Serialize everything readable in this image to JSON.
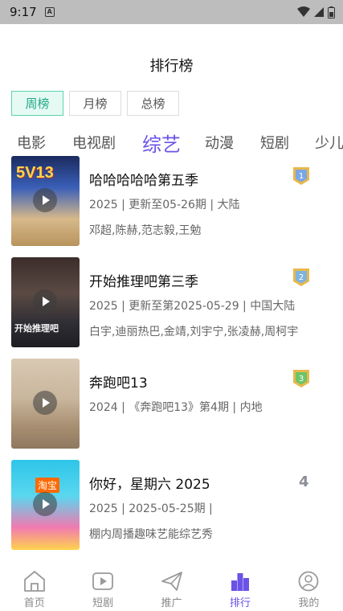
{
  "status_bar": {
    "time": "9:17",
    "notif_glyph": "A"
  },
  "header": {
    "title": "排行榜"
  },
  "period_tabs": [
    {
      "label": "周榜",
      "active": true
    },
    {
      "label": "月榜",
      "active": false
    },
    {
      "label": "总榜",
      "active": false
    }
  ],
  "category_tabs": [
    {
      "label": "电影"
    },
    {
      "label": "电视剧"
    },
    {
      "label": "综艺",
      "active": true
    },
    {
      "label": "动漫"
    },
    {
      "label": "短剧"
    },
    {
      "label": "少儿"
    }
  ],
  "items": [
    {
      "rank": "1",
      "title": "哈哈哈哈哈第五季",
      "meta": "2025 | 更新至05-26期 | 大陆",
      "cast": "邓超,陈赫,范志毅,王勉",
      "poster_text": "5V13"
    },
    {
      "rank": "2",
      "title": "开始推理吧第三季",
      "meta": "2025 | 更新至第2025-05-29 | 中国大陆",
      "cast": "白宇,迪丽热巴,金靖,刘宇宁,张凌赫,周柯宇",
      "poster_text": "开始推理吧"
    },
    {
      "rank": "3",
      "title": "奔跑吧13",
      "meta": "2024 | 《奔跑吧13》第4期 | 内地",
      "cast": ""
    },
    {
      "rank": "4",
      "title": "你好，星期六 2025",
      "meta": "2025 | 2025-05-25期 |",
      "cast": "棚内周播趣味艺能综艺秀",
      "poster_text": "淘宝"
    }
  ],
  "bottom_nav": [
    {
      "label": "首页",
      "icon": "home-icon"
    },
    {
      "label": "短剧",
      "icon": "play-video-icon"
    },
    {
      "label": "推广",
      "icon": "paper-plane-icon"
    },
    {
      "label": "排行",
      "icon": "ranking-icon",
      "active": true
    },
    {
      "label": "我的",
      "icon": "profile-icon"
    }
  ],
  "colors": {
    "accent": "#6b52e8",
    "tab_active": "#20a985",
    "gold": "#e8b84a",
    "silver": "#7fb3e0",
    "bronze": "#6cc46a"
  }
}
